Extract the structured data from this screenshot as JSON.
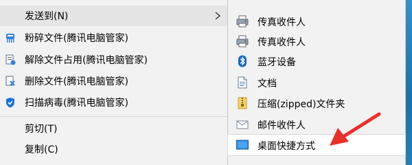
{
  "main_menu": {
    "items": [
      {
        "label": "发送到(N)",
        "icon": "none",
        "has_submenu": true
      },
      {
        "label": "粉碎文件(腾讯电脑管家)",
        "icon": "shredder-icon"
      },
      {
        "label": "解除文件占用(腾讯电脑管家)",
        "icon": "unlock-file-icon"
      },
      {
        "label": "删除文件(腾讯电脑管家)",
        "icon": "delete-file-icon"
      },
      {
        "label": "扫描病毒(腾讯电脑管家)",
        "icon": "shield-icon"
      },
      {
        "label": "剪切(T)",
        "icon": "none"
      },
      {
        "label": "复制(C)",
        "icon": "none"
      }
    ]
  },
  "send_to_menu": {
    "items": [
      {
        "label": "传真收件人",
        "icon": "fax-icon"
      },
      {
        "label": "传真收件人",
        "icon": "fax-icon"
      },
      {
        "label": "蓝牙设备",
        "icon": "bluetooth-icon"
      },
      {
        "label": "文档",
        "icon": "documents-icon"
      },
      {
        "label": "压缩(zipped)文件夹",
        "icon": "zip-folder-icon"
      },
      {
        "label": "邮件收件人",
        "icon": "mail-icon"
      },
      {
        "label": "桌面快捷方式",
        "icon": "desktop-shortcut-icon",
        "selected": true
      }
    ]
  },
  "colors": {
    "menu_bg": "#f2f2f2",
    "hover_bg": "#e5e5e5",
    "selected_bg": "#ffffff",
    "annotation_red": "#e8312c",
    "tencent_blue": "#1a73d9"
  }
}
